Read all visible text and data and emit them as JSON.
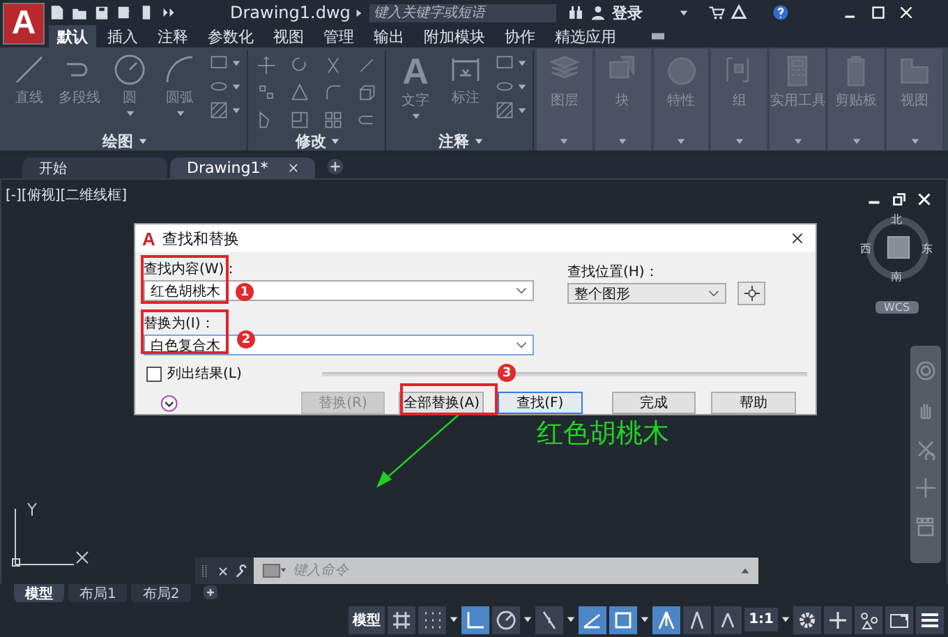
{
  "app": {
    "logo": "A",
    "file_title": "Drawing1.dwg",
    "search": {
      "placeholder": "键入关键字或短语"
    },
    "login": "登录"
  },
  "ribbon_tabs": [
    {
      "label": "默认",
      "selected": true
    },
    {
      "label": "插入",
      "selected": false
    },
    {
      "label": "注释",
      "selected": false
    },
    {
      "label": "参数化",
      "selected": false
    },
    {
      "label": "视图",
      "selected": false
    },
    {
      "label": "管理",
      "selected": false
    },
    {
      "label": "输出",
      "selected": false
    },
    {
      "label": "附加模块",
      "selected": false
    },
    {
      "label": "协作",
      "selected": false
    },
    {
      "label": "精选应用",
      "selected": false
    }
  ],
  "ribbon_panels": [
    {
      "kind": "tools",
      "title": "绘图",
      "tools": [
        {
          "label": "直线",
          "menu": false
        },
        {
          "label": "多段线",
          "menu": false
        },
        {
          "label": "圆",
          "menu": true
        },
        {
          "label": "圆弧",
          "menu": true
        }
      ]
    },
    {
      "kind": "grid",
      "title": "修改"
    },
    {
      "kind": "tools",
      "title": "注释",
      "tools": [
        {
          "label": "文字",
          "glyph": "A",
          "menu": true
        },
        {
          "label": "标注",
          "menu": false
        }
      ]
    },
    {
      "kind": "big",
      "title": "图层"
    },
    {
      "kind": "big",
      "title": "块"
    },
    {
      "kind": "big",
      "title": "特性"
    },
    {
      "kind": "big",
      "title": "组"
    },
    {
      "kind": "big",
      "title": "实用工具"
    },
    {
      "kind": "big",
      "title": "剪贴板"
    },
    {
      "kind": "big",
      "title": "视图"
    }
  ],
  "doc_tabs": [
    {
      "label": "开始",
      "selected": false
    },
    {
      "label": "Drawing1*",
      "selected": true
    }
  ],
  "viewport_label": "[-][俯视][二维线框]",
  "viewcube": {
    "north": "北",
    "south": "南",
    "west": "西",
    "east": "东",
    "ucs": "WCS"
  },
  "canvas_text": "红色胡桃木",
  "dialog": {
    "logo": "A",
    "title": "查找和替换",
    "find": {
      "label": "查找内容(W)：",
      "value": "红色胡桃木"
    },
    "replace": {
      "label": "替换为(I)：",
      "value": "白色复合木"
    },
    "scope": {
      "label": "查找位置(H)：",
      "value": "整个图形"
    },
    "list_results": {
      "label": "列出结果(L)",
      "checked": false
    },
    "buttons": [
      {
        "label": "替换(R)",
        "disabled": true,
        "focused": false
      },
      {
        "label": "全部替换(A)",
        "disabled": false,
        "focused": false
      },
      {
        "label": "查找(F)",
        "disabled": false,
        "focused": true
      },
      {
        "label": "完成",
        "disabled": false,
        "focused": false
      },
      {
        "label": "帮助",
        "disabled": false,
        "focused": false
      }
    ]
  },
  "annotations": [
    "1",
    "2",
    "3"
  ],
  "command_line": {
    "placeholder": "键入命令"
  },
  "layout_tabs": [
    {
      "label": "模型",
      "selected": true
    },
    {
      "label": "布局1",
      "selected": false
    },
    {
      "label": "布局2",
      "selected": false
    }
  ],
  "status_bar": {
    "space": "模型",
    "scale": "1:1",
    "toggles": [
      {
        "on": false
      },
      {
        "on": false
      },
      {
        "on": true
      },
      {
        "on": false
      },
      {
        "on": false
      },
      {
        "on": true
      },
      {
        "on": true
      },
      {
        "on": true
      },
      {
        "on": false
      },
      {
        "on": false
      }
    ]
  }
}
